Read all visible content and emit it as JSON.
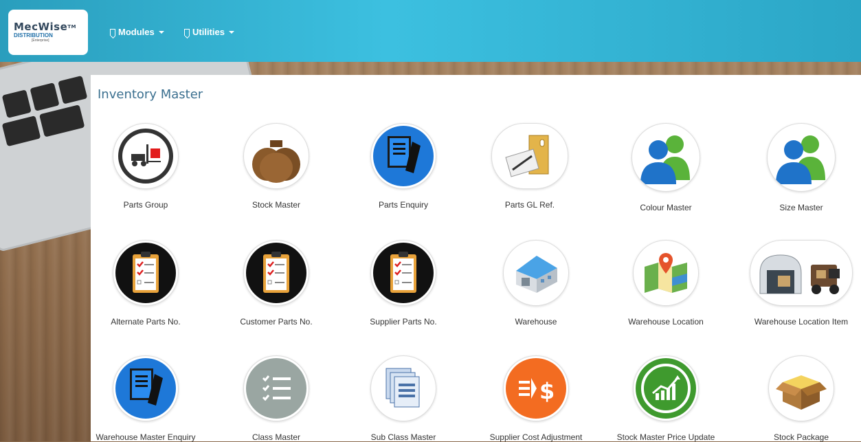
{
  "brand": {
    "name": "MecWise",
    "tm": "TM",
    "line2": "DISTRIBUTION",
    "line3": "[Enterprise]"
  },
  "nav": {
    "modules": "Modules",
    "utilities": "Utilities"
  },
  "page": {
    "title": "Inventory Master"
  },
  "tiles": [
    {
      "label": "Parts Group",
      "icon": "forklift-icon"
    },
    {
      "label": "Stock Master",
      "icon": "money-bags-icon"
    },
    {
      "label": "Parts Enquiry",
      "icon": "documents-icon"
    },
    {
      "label": "Parts GL Ref.",
      "icon": "binder-icon"
    },
    {
      "label": "Colour Master",
      "icon": "users-icon"
    },
    {
      "label": "Size Master",
      "icon": "users-icon"
    },
    {
      "label": "Alternate Parts No.",
      "icon": "clipboard-checklist-icon"
    },
    {
      "label": "Customer Parts No.",
      "icon": "clipboard-checklist-icon"
    },
    {
      "label": "Supplier Parts No.",
      "icon": "clipboard-checklist-icon"
    },
    {
      "label": "Warehouse",
      "icon": "warehouse-icon"
    },
    {
      "label": "Warehouse Location",
      "icon": "map-pin-icon"
    },
    {
      "label": "Warehouse Location Item",
      "icon": "garage-truck-icon"
    },
    {
      "label": "Warehouse Master Enquiry",
      "icon": "documents-icon"
    },
    {
      "label": "Class Master",
      "icon": "list-icon"
    },
    {
      "label": "Sub Class Master",
      "icon": "stacked-pages-icon"
    },
    {
      "label": "Supplier Cost Adjustment",
      "icon": "dollar-arrows-icon"
    },
    {
      "label": "Stock Master Price Update",
      "icon": "chart-up-icon"
    },
    {
      "label": "Stock Package",
      "icon": "package-box-icon"
    }
  ],
  "colors": {
    "nav": "#3cc0e0",
    "title": "#3a6f8f",
    "blue": "#1e78d8",
    "orange": "#f36c21",
    "green": "#5aa63a"
  }
}
